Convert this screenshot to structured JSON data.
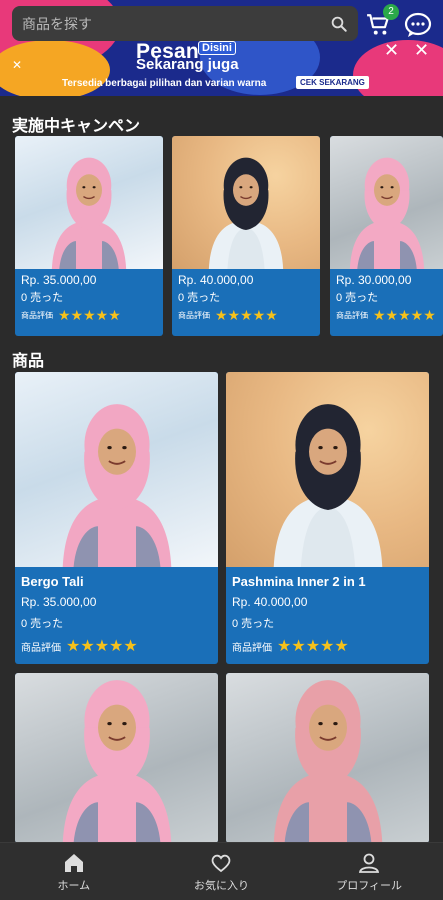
{
  "search": {
    "placeholder": "商品を探す"
  },
  "cart": {
    "badge": "2"
  },
  "banner": {
    "headline": "Pesan",
    "badge": "Disini",
    "sub": "Sekarang juga",
    "tagline": "Tersedia berbagai pilihan dan varian warna",
    "cta": "CEK SEKARANG"
  },
  "campaign": {
    "title": "実施中キャンペン",
    "items": [
      {
        "price": "Rp. 35.000,00",
        "sold": "0 売った",
        "rating_label": "商品評価",
        "stars": "★★★★★",
        "bg": "blue",
        "hijab": "#f2a7c3"
      },
      {
        "price": "Rp. 40.000,00",
        "sold": "0 売った",
        "rating_label": "商品評価",
        "stars": "★★★★★",
        "bg": "gold",
        "hijab": "#222532"
      },
      {
        "price": "Rp. 30.000,00",
        "sold": "0 売った",
        "rating_label": "商品評価",
        "stars": "★★★★★",
        "bg": "grey",
        "hijab": "#f3a9c4"
      }
    ]
  },
  "products": {
    "title": "商品",
    "items": [
      {
        "name": "Bergo Tali",
        "price": "Rp. 35.000,00",
        "sold": "0 売った",
        "rating_label": "商品評価",
        "stars": "★★★★★",
        "bg": "blue",
        "hijab": "#f2a7c3"
      },
      {
        "name": "Pashmina Inner 2 in 1",
        "price": "Rp. 40.000,00",
        "sold": "0 売った",
        "rating_label": "商品評価",
        "stars": "★★★★★",
        "bg": "gold",
        "hijab": "#222532"
      },
      {
        "name": "",
        "price": "",
        "sold": "",
        "rating_label": "",
        "stars": "",
        "bg": "grey",
        "hijab": "#f3a9c4"
      },
      {
        "name": "",
        "price": "",
        "sold": "",
        "rating_label": "",
        "stars": "",
        "bg": "grey",
        "hijab": "#e8a0a8"
      }
    ]
  },
  "nav": {
    "home": "ホーム",
    "favorites": "お気に入り",
    "profile": "プロフィール"
  },
  "colors": {
    "accent": "#1a6fb8",
    "star": "#f6c11b",
    "badge": "#2ba84a",
    "background": "#2b2b2b"
  }
}
